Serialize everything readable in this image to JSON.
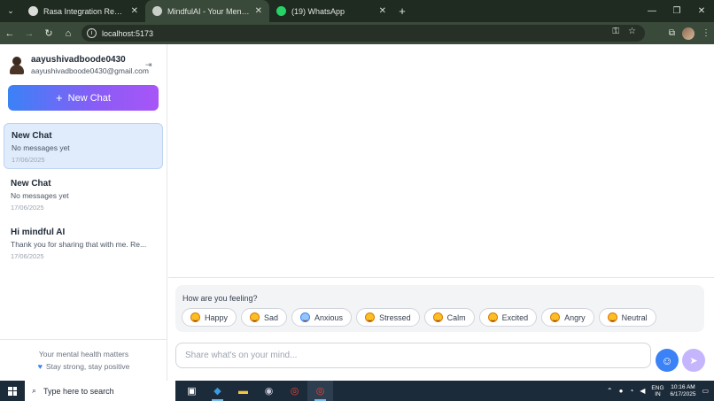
{
  "browser": {
    "tabs": [
      {
        "title": "Rasa Integration React Flask",
        "favicon_color": "#ffffff"
      },
      {
        "title": "MindfulAI - Your Mental Health",
        "favicon_color": "#ffffff",
        "active": true
      },
      {
        "title": "(19) WhatsApp",
        "favicon_color": "#25d366"
      }
    ],
    "url": "localhost:5173"
  },
  "sidebar": {
    "user": {
      "name": "aayushivadboode0430",
      "email": "aayushivadboode0430@gmail.com"
    },
    "new_chat_label": "New Chat",
    "chats": [
      {
        "title": "New Chat",
        "preview": "No messages yet",
        "date": "17/06/2025",
        "active": true
      },
      {
        "title": "New Chat",
        "preview": "No messages yet",
        "date": "17/06/2025"
      },
      {
        "title": "Hi mindful AI",
        "preview": "Thank you for sharing that with me. Re...",
        "date": "17/06/2025"
      }
    ],
    "footer": {
      "line1": "Your mental health matters",
      "line2": "Stay strong, stay positive"
    }
  },
  "mood": {
    "question": "How are you feeling?",
    "options": [
      "Happy",
      "Sad",
      "Anxious",
      "Stressed",
      "Calm",
      "Excited",
      "Angry",
      "Neutral"
    ]
  },
  "input": {
    "placeholder": "Share what's on your mind..."
  },
  "taskbar": {
    "search_placeholder": "Type here to search",
    "lang_line1": "ENG",
    "lang_line2": "IN",
    "time": "10:16 AM",
    "date": "6/17/2025"
  },
  "colors": {
    "accent_blue": "#3b82f6",
    "accent_purple": "#a855f7",
    "active_chat_bg": "#e0ecfb"
  }
}
